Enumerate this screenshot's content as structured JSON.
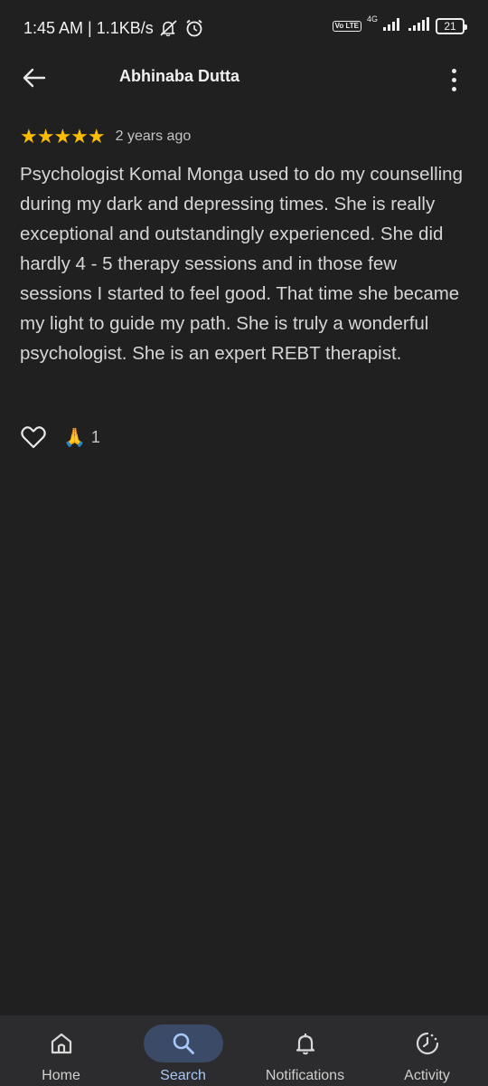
{
  "status_bar": {
    "time_speed": "1:45 AM | 1.1KB/s",
    "network": "4G",
    "volte": "Vo LTE",
    "battery": "21"
  },
  "header": {
    "title": "Abhinaba Dutta"
  },
  "review": {
    "stars": "★★★★★",
    "rating": 5,
    "age": "2 years ago",
    "text": "Psychologist Komal Monga used to do my counselling during my dark and depressing times. She is really exceptional and outstandingly experienced. She did hardly 4 - 5 therapy sessions and in those few sessions I started to feel good. That time she became my light to guide my path. She is truly a wonderful psychologist. She is an expert REBT therapist.",
    "reaction_emoji": "🙏",
    "reaction_count": "1"
  },
  "bottom_nav": {
    "items": [
      {
        "label": "Home",
        "icon": "home-icon"
      },
      {
        "label": "Search",
        "icon": "search-icon",
        "active": true
      },
      {
        "label": "Notifications",
        "icon": "bell-icon"
      },
      {
        "label": "Activity",
        "icon": "activity-icon"
      }
    ]
  },
  "colors": {
    "background": "#202020",
    "star": "#fbbc04",
    "active_nav_bg": "#3b4a66",
    "active_nav_label": "#a8c7fa",
    "nav_bar": "#2c2c2e"
  }
}
